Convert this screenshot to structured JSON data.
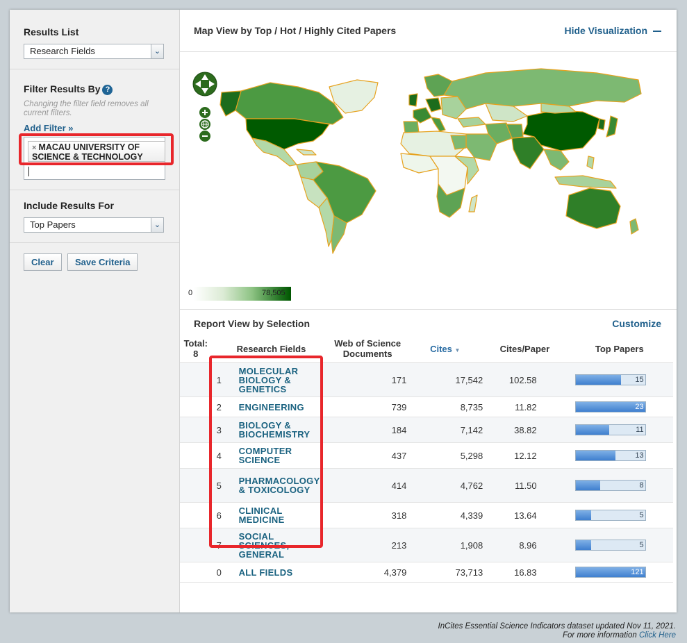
{
  "sidebar": {
    "results_list_title": "Results List",
    "results_list_value": "Research Fields",
    "filter_title": "Filter Results By",
    "filter_note": "Changing the filter field removes all current filters.",
    "add_filter": "Add Filter »",
    "chip_label": "MACAU UNIVERSITY OF SCIENCE & TECHNOLOGY",
    "include_title": "Include Results For",
    "include_value": "Top Papers",
    "clear_label": "Clear",
    "save_label": "Save Criteria"
  },
  "map": {
    "title": "Map View by Top / Hot / Highly Cited Papers",
    "hide_label": "Hide Visualization",
    "legend_min": "0",
    "legend_max": "78,505"
  },
  "report": {
    "title": "Report View by Selection",
    "customize": "Customize",
    "col_total": "Total: 8",
    "col_fields": "Research Fields",
    "col_docs": "Web of Science Documents",
    "col_cites": "Cites",
    "col_cpp": "Cites/Paper",
    "col_top": "Top Papers",
    "rows": [
      {
        "rank": "1",
        "field": "MOLECULAR BIOLOGY & GENETICS",
        "docs": "171",
        "cites": "17,542",
        "cpp": "102.58",
        "top": "15",
        "frac": 0.65
      },
      {
        "rank": "2",
        "field": "ENGINEERING",
        "docs": "739",
        "cites": "8,735",
        "cpp": "11.82",
        "top": "23",
        "frac": 1.0
      },
      {
        "rank": "3",
        "field": "BIOLOGY & BIOCHEMISTRY",
        "docs": "184",
        "cites": "7,142",
        "cpp": "38.82",
        "top": "11",
        "frac": 0.48
      },
      {
        "rank": "4",
        "field": "COMPUTER SCIENCE",
        "docs": "437",
        "cites": "5,298",
        "cpp": "12.12",
        "top": "13",
        "frac": 0.57
      },
      {
        "rank": "5",
        "field": "PHARMACOLOGY & TOXICOLOGY",
        "docs": "414",
        "cites": "4,762",
        "cpp": "11.50",
        "top": "8",
        "frac": 0.35
      },
      {
        "rank": "6",
        "field": "CLINICAL MEDICINE",
        "docs": "318",
        "cites": "4,339",
        "cpp": "13.64",
        "top": "5",
        "frac": 0.22
      },
      {
        "rank": "7",
        "field": "SOCIAL SCIENCES, GENERAL",
        "docs": "213",
        "cites": "1,908",
        "cpp": "8.96",
        "top": "5",
        "frac": 0.22
      },
      {
        "rank": "0",
        "field": "ALL FIELDS",
        "docs": "4,379",
        "cites": "73,713",
        "cpp": "16.83",
        "top": "121",
        "frac": 1.0
      }
    ]
  },
  "footer": {
    "line1": "InCites Essential Science Indicators dataset updated Nov 11, 2021.",
    "line2_prefix": "For more information ",
    "line2_link": "Click Here"
  }
}
